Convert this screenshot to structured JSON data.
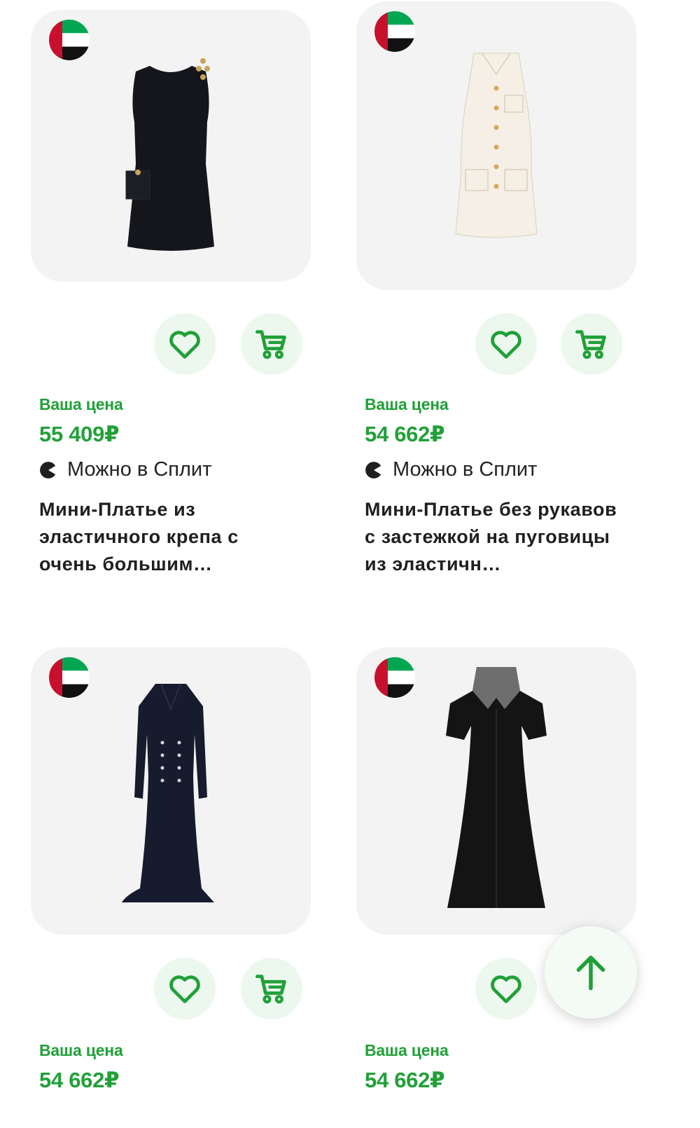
{
  "colors": {
    "accent": "#21a038",
    "card_bg": "#f3f3f3",
    "button_bg": "#ecf8ee",
    "text_dark": "#1f1f1f"
  },
  "products": [
    {
      "price_label": "Ваша цена",
      "price": "55 409₽",
      "split_label": "Можно в Сплит",
      "title": "Мини-Платье из эластичного крепа с очень большим…",
      "flag_icon": "uae-flag-icon"
    },
    {
      "price_label": "Ваша цена",
      "price": "54 662₽",
      "split_label": "Можно в Сплит",
      "title": "Мини-Платье без рукавов с застежкой на пуговицы из эластичн…",
      "flag_icon": "uae-flag-icon"
    },
    {
      "price_label": "Ваша цена",
      "price": "54 662₽",
      "flag_icon": "uae-flag-icon"
    },
    {
      "price_label": "Ваша цена",
      "price": "54 662₽",
      "flag_icon": "uae-flag-icon"
    }
  ],
  "icons": {
    "favorite": "heart-icon",
    "cart": "cart-icon",
    "split": "split-icon",
    "scroll_top": "arrow-up-icon"
  }
}
